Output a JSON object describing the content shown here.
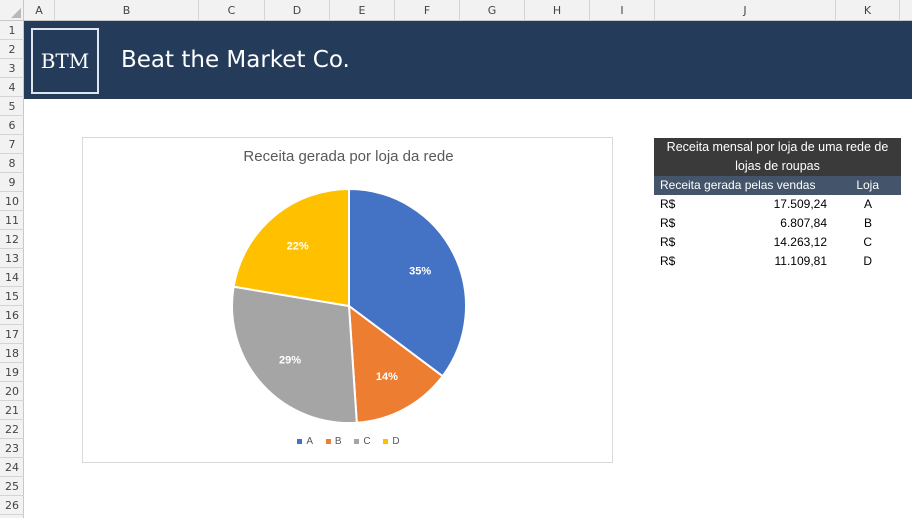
{
  "sheet": {
    "columns": [
      "A",
      "B",
      "C",
      "D",
      "E",
      "F",
      "G",
      "H",
      "I",
      "J",
      "K"
    ],
    "rows": [
      "1",
      "2",
      "3",
      "4",
      "5",
      "6",
      "7",
      "8",
      "9",
      "10",
      "11",
      "12",
      "13",
      "14",
      "15",
      "16",
      "17",
      "18",
      "19",
      "20",
      "21",
      "22",
      "23",
      "24",
      "25",
      "26"
    ]
  },
  "banner": {
    "logo": "BTM",
    "company": "Beat the Market Co.",
    "color": "#243b5a"
  },
  "chart": {
    "title": "Receita gerada por loja da rede",
    "legend": [
      "A",
      "B",
      "C",
      "D"
    ],
    "slice_labels": [
      "35%",
      "14%",
      "29%",
      "22%"
    ]
  },
  "chart_data": {
    "type": "pie",
    "title": "Receita gerada por loja da rede",
    "categories": [
      "A",
      "B",
      "C",
      "D"
    ],
    "values": [
      17509.24,
      6807.84,
      14263.12,
      11109.81
    ],
    "percent_labels": [
      "35%",
      "14%",
      "29%",
      "22%"
    ],
    "colors": [
      "#4472c4",
      "#ed7d31",
      "#a5a5a5",
      "#ffc000"
    ],
    "legend_position": "bottom"
  },
  "table": {
    "title": "Receita mensal por loja de uma rede de lojas de roupas",
    "header_revenue": "Receita gerada pelas vendas",
    "header_store": "Loja",
    "rows": [
      {
        "currency": "R$",
        "value": "17.509,24",
        "store": "A"
      },
      {
        "currency": "R$",
        "value": "6.807,84",
        "store": "B"
      },
      {
        "currency": "R$",
        "value": "14.263,12",
        "store": "C"
      },
      {
        "currency": "R$",
        "value": "11.109,81",
        "store": "D"
      }
    ]
  }
}
